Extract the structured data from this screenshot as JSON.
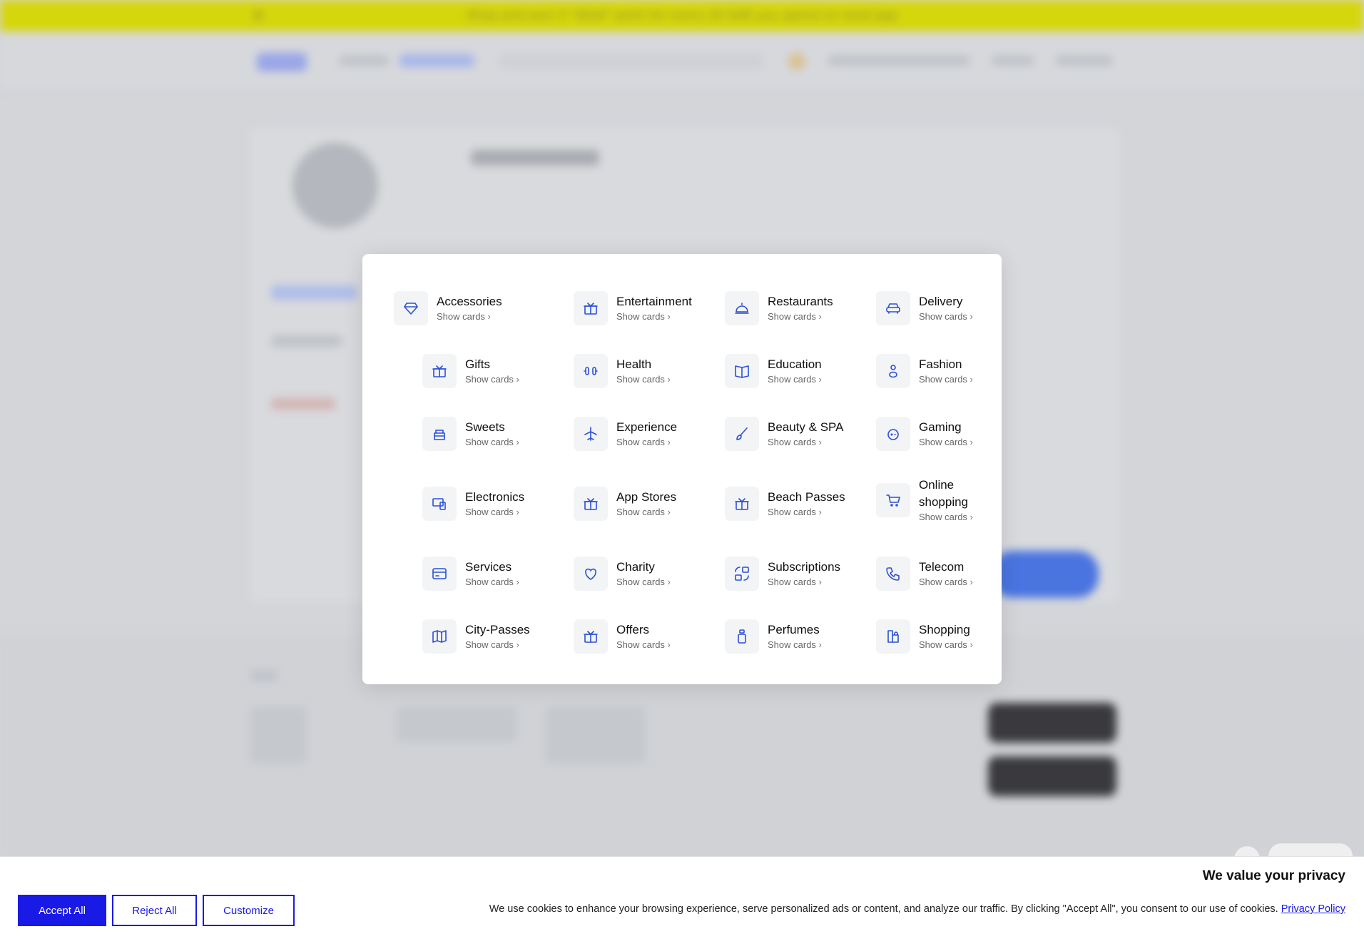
{
  "promo": {
    "text": "Shop and earn 5 \"Qitaf\" point for every 20 SAR you spend on resal.app"
  },
  "modal": {
    "show_cards_label": "Show cards",
    "categories": [
      {
        "name": "Accessories",
        "icon": "diamond-icon"
      },
      {
        "name": "Entertainment",
        "icon": "gift-box-icon"
      },
      {
        "name": "Restaurants",
        "icon": "cloche-icon"
      },
      {
        "name": "Delivery",
        "icon": "car-icon"
      },
      {
        "name": "Gifts",
        "icon": "gift-box-icon"
      },
      {
        "name": "Health",
        "icon": "dumbbell-icon"
      },
      {
        "name": "Education",
        "icon": "book-icon"
      },
      {
        "name": "Fashion",
        "icon": "person-icon"
      },
      {
        "name": "Sweets",
        "icon": "cake-icon"
      },
      {
        "name": "Experience",
        "icon": "airplane-icon"
      },
      {
        "name": "Beauty & SPA",
        "icon": "brush-icon"
      },
      {
        "name": "Gaming",
        "icon": "gamepad-icon"
      },
      {
        "name": "Electronics",
        "icon": "devices-icon"
      },
      {
        "name": "App Stores",
        "icon": "gift-box-icon"
      },
      {
        "name": "Beach Passes",
        "icon": "gift-box-icon"
      },
      {
        "name": "Online shopping",
        "icon": "cart-icon"
      },
      {
        "name": "Services",
        "icon": "card-icon"
      },
      {
        "name": "Charity",
        "icon": "heart-hand-icon"
      },
      {
        "name": "Subscriptions",
        "icon": "subscriptions-icon"
      },
      {
        "name": "Telecom",
        "icon": "phone-icon"
      },
      {
        "name": "City-Passes",
        "icon": "map-icon"
      },
      {
        "name": "Offers",
        "icon": "gift-box-icon"
      },
      {
        "name": "Perfumes",
        "icon": "perfume-icon"
      },
      {
        "name": "Shopping",
        "icon": "shopping-bag-icon"
      }
    ]
  },
  "cookie": {
    "title": "We value your privacy",
    "accept_label": "Accept All",
    "reject_label": "Reject All",
    "customize_label": "Customize",
    "message": "We use cookies to enhance your browsing experience, serve personalized ads or content, and analyze our traffic. By clicking \"Accept All\", you consent to our use of cookies.",
    "policy_link": "Privacy Policy"
  },
  "colors": {
    "accent": "#2b4fd8",
    "cookie_button": "#1a1ae6",
    "promo_bar": "#d6d60c"
  }
}
